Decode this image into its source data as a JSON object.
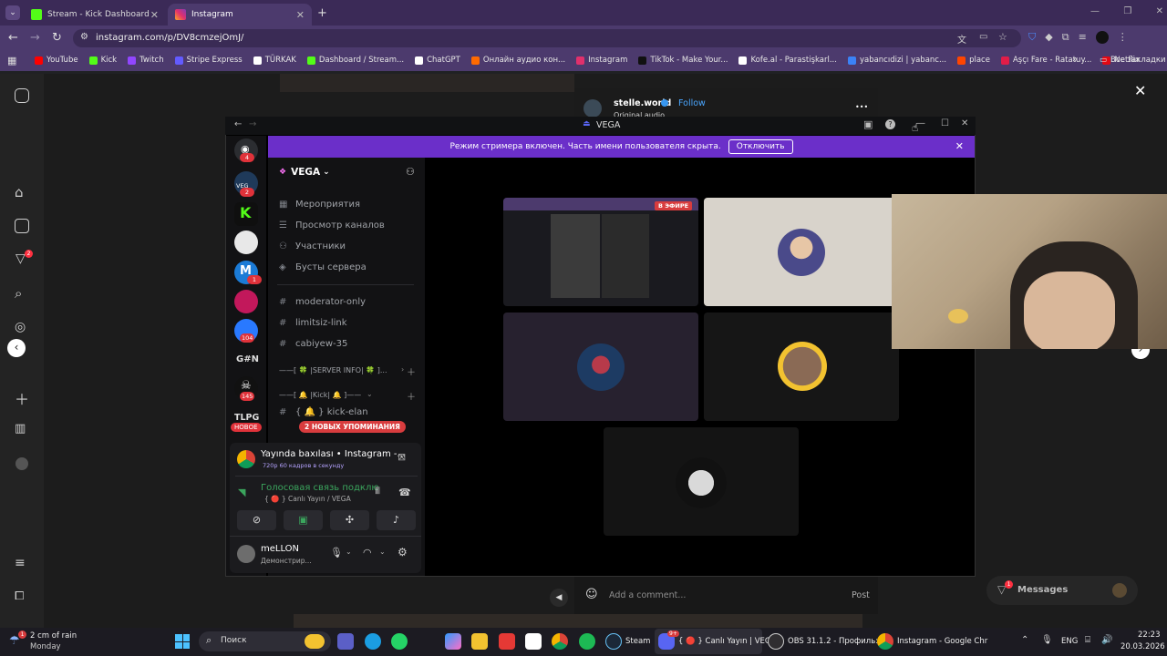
{
  "browser": {
    "tabs": [
      {
        "title": "Stream - Kick Dashboard",
        "active": false
      },
      {
        "title": "Instagram",
        "active": true
      }
    ],
    "new_tab": "+",
    "url": "instagram.com/p/DV8cmzejOmJ/",
    "bookmarks": [
      {
        "label": "YouTube",
        "color": "#ff0000"
      },
      {
        "label": "Kick",
        "color": "#53fc18"
      },
      {
        "label": "Twitch",
        "color": "#9146ff"
      },
      {
        "label": "Stripe Express",
        "color": "#635bff"
      },
      {
        "label": "TÜRKAK",
        "color": "#ffffff"
      },
      {
        "label": "Dashboard / Stream...",
        "color": "#53fc18"
      },
      {
        "label": "ChatGPT",
        "color": "#ffffff"
      },
      {
        "label": "Онлайн аудио кон...",
        "color": "#ff6a00"
      },
      {
        "label": "Instagram",
        "color": "#e1306c"
      },
      {
        "label": "TikTok - Make Your...",
        "color": "#111111"
      },
      {
        "label": "Kofe.al - Parastişkarl...",
        "color": "#ffffff"
      },
      {
        "label": "yabancıdizi | yabanc...",
        "color": "#3b82f6"
      },
      {
        "label": "place",
        "color": "#ff4500"
      },
      {
        "label": "Aşçı Fare - Ratatuy...",
        "color": "#e11d48"
      },
      {
        "label": "Netflix",
        "color": "#e50914"
      }
    ],
    "bookmarks_more": "»",
    "all_bookmarks": "Все закладки"
  },
  "instagram": {
    "author": "stelle.world",
    "follow": "Follow",
    "audio": "Original audio",
    "more": "•••",
    "close": "✕",
    "comment_placeholder": "Add a comment...",
    "post": "Post",
    "messages": "Messages",
    "messages_badge": "1",
    "notif_badge": "2"
  },
  "discord": {
    "title": "VEGA",
    "banner_text": "Режим стримера включен. Часть имени пользователя скрыта.",
    "banner_button": "Отключить",
    "server_name": "VEGA",
    "menu": [
      "Мероприятия",
      "Просмотр каналов",
      "Участники",
      "Бусты сервера"
    ],
    "channels": [
      "moderator-only",
      "limitsiz-link",
      "cabiyew-35"
    ],
    "categories": [
      "——[ 🍀 |SERVER INFO| 🍀 ]...",
      "——[ 🔔 |Kick| 🔔 ]——"
    ],
    "kick_channel": "{ 🔔 } kick-elan",
    "mentions_pill": "2 НОВЫХ УПОМИНАНИЯ",
    "new_badge": "НОВОЕ",
    "guild_badges": [
      "4",
      "2",
      "1",
      "104",
      "145"
    ],
    "guild_text": [
      "G#N",
      "TLPG",
      "VEG"
    ],
    "stream_title": "Yayında baxılası • Instagram -...",
    "stream_quality": "720p 60 кадров в секунду",
    "voice_status": "Голосовая связь подклю",
    "voice_channel": "{ 🔴 } Canlı Yayın / VEGA",
    "username": "meLLON",
    "user_status": "Демонстрир...",
    "live_badge": "В ЭФИРЕ"
  },
  "taskbar": {
    "weather": "2 cm of rain",
    "weather_day": "Monday",
    "weather_badge": "1",
    "search": "Поиск",
    "apps": [
      {
        "label": "Steam"
      },
      {
        "label": "{ 🔴 } Canlı Yayın | VEGA"
      },
      {
        "label": "OBS 31.1.2 - Профиль: E"
      },
      {
        "label": "Instagram - Google Chr"
      }
    ],
    "discord_badge": "9+",
    "lang": "ENG",
    "time": "22:23",
    "date": "20.03.2026"
  }
}
